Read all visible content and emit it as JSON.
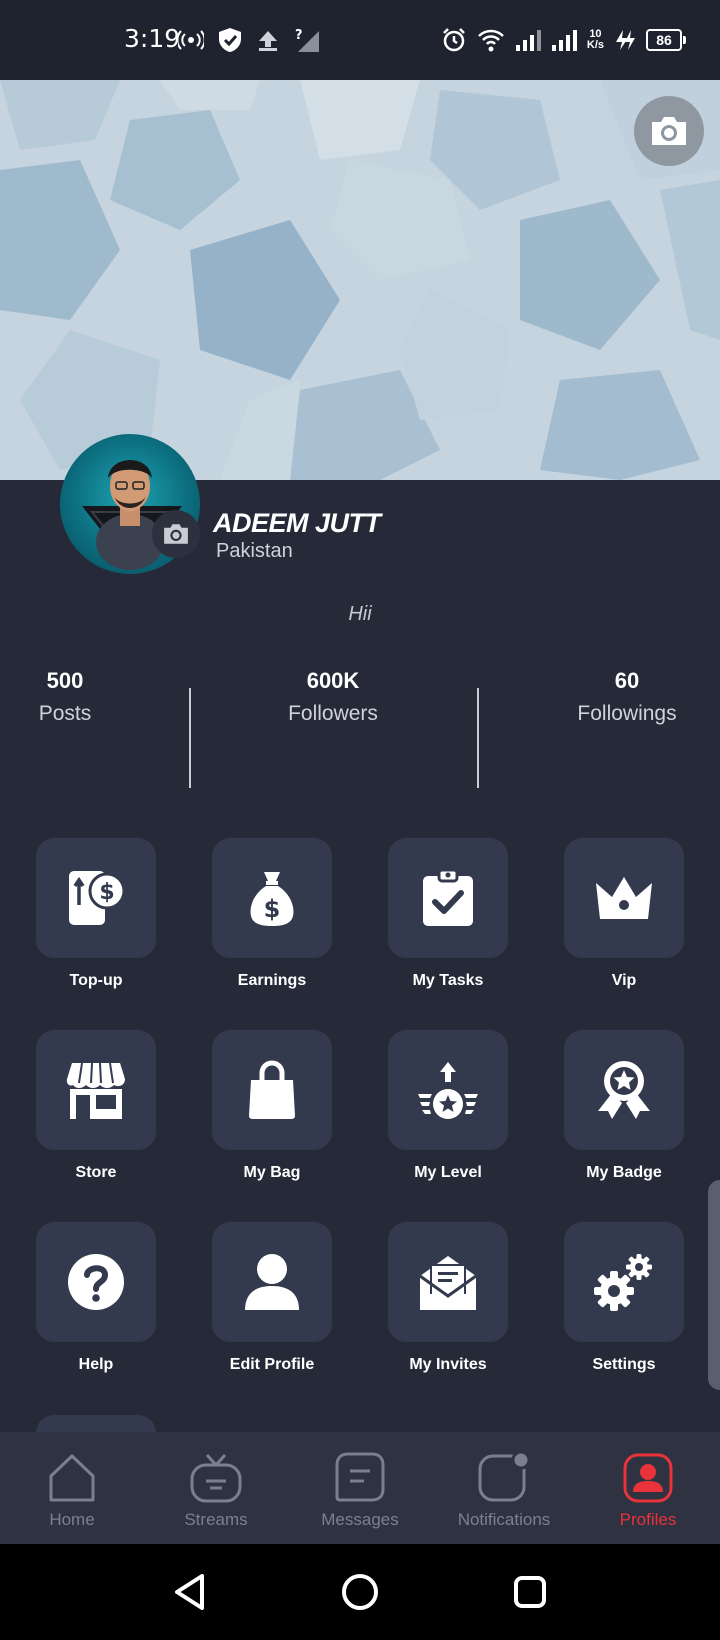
{
  "status_bar": {
    "time": "3:19",
    "net_speed_value": "10",
    "net_speed_unit": "K/s",
    "battery": "86"
  },
  "profile": {
    "name": "ADEEM JUTT",
    "country": "Pakistan",
    "bio": "Hii"
  },
  "stats": [
    {
      "value": "500",
      "label": "Posts"
    },
    {
      "value": "600K",
      "label": "Followers"
    },
    {
      "value": "60",
      "label": "Followings"
    }
  ],
  "menu": [
    {
      "label": "Top-up",
      "icon": "topup-icon"
    },
    {
      "label": "Earnings",
      "icon": "money-bag-icon"
    },
    {
      "label": "My Tasks",
      "icon": "clipboard-check-icon"
    },
    {
      "label": "Vip",
      "icon": "crown-icon"
    },
    {
      "label": "Store",
      "icon": "store-icon"
    },
    {
      "label": "My Bag",
      "icon": "shopping-bag-icon"
    },
    {
      "label": "My Level",
      "icon": "level-icon"
    },
    {
      "label": "My Badge",
      "icon": "badge-icon"
    },
    {
      "label": "Help",
      "icon": "help-icon"
    },
    {
      "label": "Edit Profile",
      "icon": "user-icon"
    },
    {
      "label": "My Invites",
      "icon": "invite-icon"
    },
    {
      "label": "Settings",
      "icon": "gears-icon"
    }
  ],
  "nav": [
    {
      "label": "Home",
      "icon": "home-icon"
    },
    {
      "label": "Streams",
      "icon": "tv-icon"
    },
    {
      "label": "Messages",
      "icon": "message-icon"
    },
    {
      "label": "Notifications",
      "icon": "notification-icon"
    },
    {
      "label": "Profiles",
      "icon": "profile-icon",
      "active": true
    }
  ],
  "colors": {
    "background": "#262a38",
    "tile": "#343a4d",
    "accent": "#e8333b"
  }
}
